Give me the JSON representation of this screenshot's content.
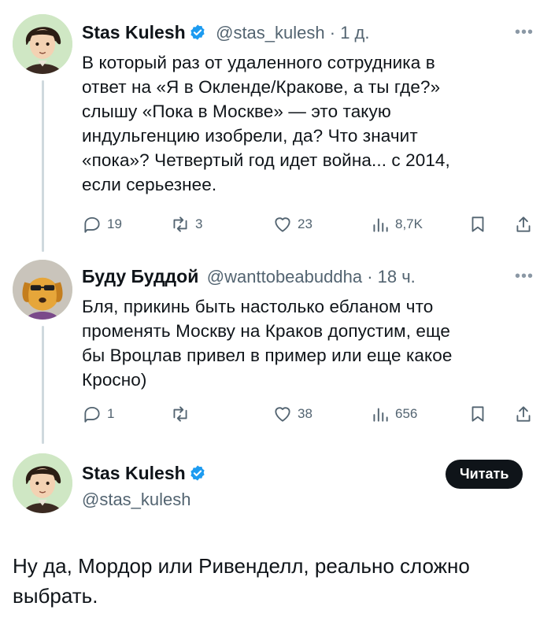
{
  "tweet1": {
    "name": "Stas Kulesh",
    "handle": "@stas_kulesh",
    "time": "1 д.",
    "lines": [
      "В который раз от удаленного сотрудника в",
      "ответ на «Я в Окленде/Кракове, а ты где?»",
      "слышу «Пока в Москве» — это такую",
      "индульгенцию изобрели, да? Что значит",
      "«пока»? Четвертый год идет война... с 2014,",
      "если серьезнее."
    ],
    "replies": "19",
    "reposts": "3",
    "likes": "23",
    "views": "8,7K"
  },
  "tweet2": {
    "name": "Буду Буддой",
    "handle": "@wanttobeabuddha",
    "time": "18 ч.",
    "lines": [
      "Бля, прикинь быть настолько ебланом что",
      "променять Москву на Краков допустим, еще",
      "бы Вроцлав привел в пример или еще какое",
      "Кросно)"
    ],
    "replies": "1",
    "reposts": "",
    "likes": "38",
    "views": "656"
  },
  "tweet3": {
    "name": "Stas Kulesh",
    "handle": "@stas_kulesh",
    "read_label": "Читать",
    "lines": [
      "Ну да, Мордор или Ривенделл, реально сложно",
      "выбрать."
    ]
  },
  "colors": {
    "verified": "#1d9bf0",
    "muted": "#536471",
    "button": "#0f1419"
  }
}
